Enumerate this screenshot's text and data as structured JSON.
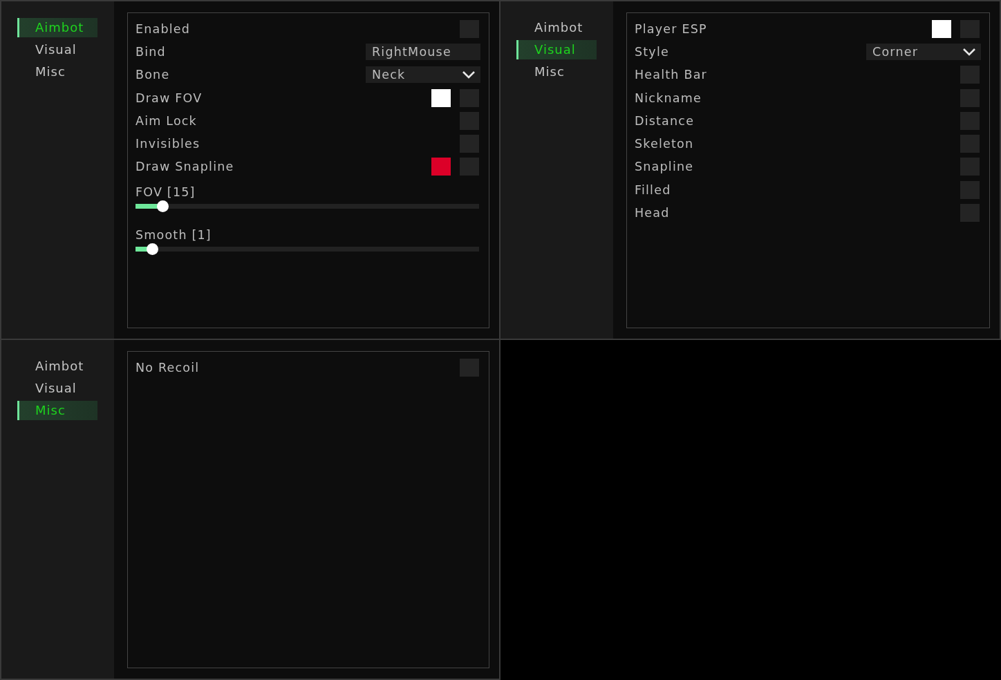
{
  "windows": [
    {
      "tabs": [
        {
          "label": "Aimbot",
          "selected": true
        },
        {
          "label": "Visual",
          "selected": false
        },
        {
          "label": "Misc",
          "selected": false
        }
      ],
      "controls": [
        {
          "kind": "checkbox",
          "label": "Enabled",
          "checked": false
        },
        {
          "kind": "keybind",
          "label": "Bind",
          "value": "RightMouse"
        },
        {
          "kind": "dropdown",
          "label": "Bone",
          "value": "Neck"
        },
        {
          "kind": "checkbox",
          "label": "Draw FOV",
          "checked": false,
          "color": "#ffffff"
        },
        {
          "kind": "checkbox",
          "label": "Aim Lock",
          "checked": false
        },
        {
          "kind": "checkbox",
          "label": "Invisibles",
          "checked": false
        },
        {
          "kind": "checkbox",
          "label": "Draw Snapline",
          "checked": false,
          "color": "#dc0028"
        },
        {
          "kind": "slider",
          "label": "FOV [15]",
          "level": 0.08
        },
        {
          "kind": "slider",
          "label": "Smooth [1]",
          "level": 0.05
        }
      ]
    },
    {
      "tabs": [
        {
          "label": "Aimbot",
          "selected": false
        },
        {
          "label": "Visual",
          "selected": true
        },
        {
          "label": "Misc",
          "selected": false
        }
      ],
      "controls": [
        {
          "kind": "checkbox",
          "label": "Player ESP",
          "checked": false,
          "color": "#ffffff"
        },
        {
          "kind": "dropdown",
          "label": "Style",
          "value": "Corner"
        },
        {
          "kind": "checkbox",
          "label": "Health Bar",
          "checked": false
        },
        {
          "kind": "checkbox",
          "label": "Nickname",
          "checked": false
        },
        {
          "kind": "checkbox",
          "label": "Distance",
          "checked": false
        },
        {
          "kind": "checkbox",
          "label": "Skeleton",
          "checked": false
        },
        {
          "kind": "checkbox",
          "label": "Snapline",
          "checked": false
        },
        {
          "kind": "checkbox",
          "label": "Filled",
          "checked": false
        },
        {
          "kind": "checkbox",
          "label": "Head",
          "checked": false
        }
      ]
    },
    {
      "tabs": [
        {
          "label": "Aimbot",
          "selected": false
        },
        {
          "label": "Visual",
          "selected": false
        },
        {
          "label": "Misc",
          "selected": true
        }
      ],
      "controls": [
        {
          "kind": "checkbox",
          "label": "No Recoil",
          "checked": false
        }
      ]
    }
  ]
}
